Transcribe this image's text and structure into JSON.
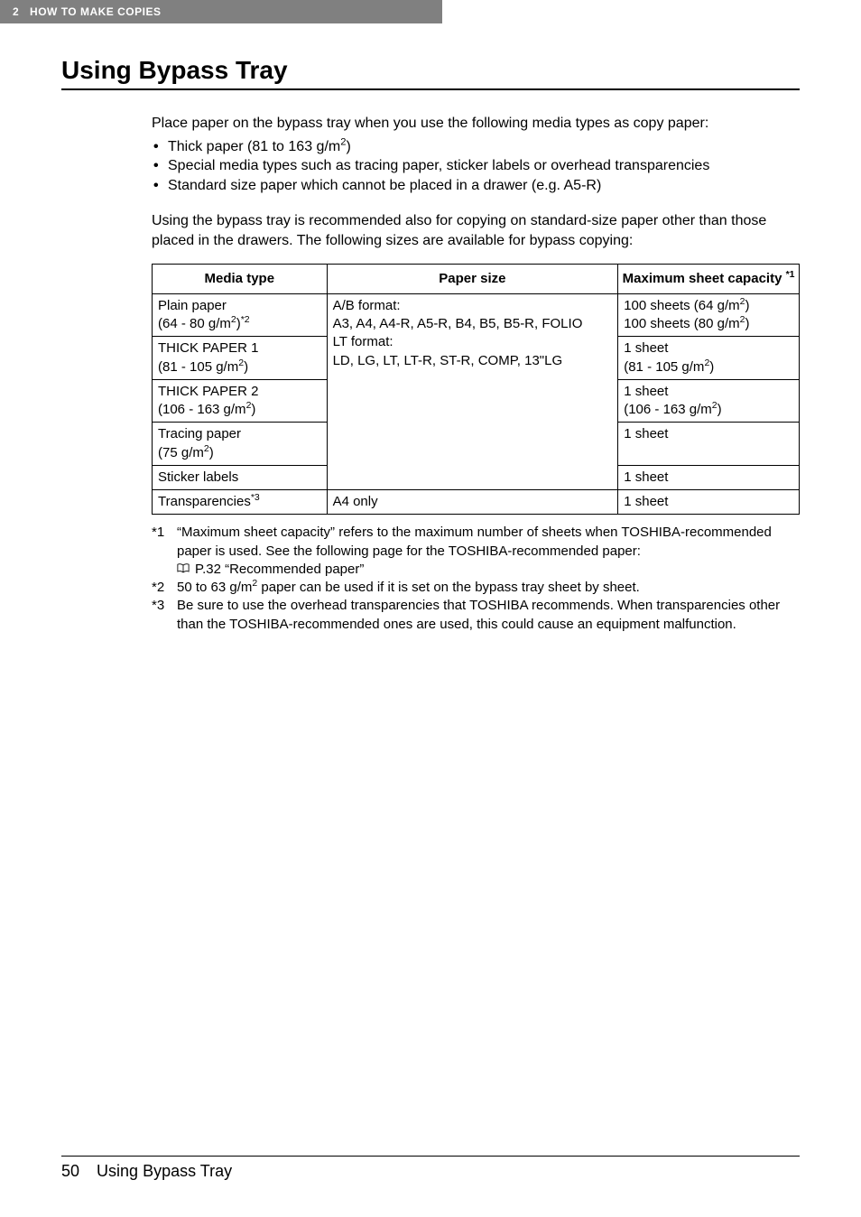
{
  "breadcrumb": {
    "num": "2",
    "label": "HOW TO MAKE COPIES"
  },
  "title": "Using Bypass Tray",
  "intro": "Place paper on the bypass tray when you use the following media types as copy paper:",
  "bullets": [
    {
      "pre": "Thick paper (81 to 163 g/m",
      "sup": "2",
      "post": ")"
    },
    {
      "text": "Special media types such as tracing paper, sticker labels or overhead transparencies"
    },
    {
      "text": "Standard size paper which cannot be placed in a drawer (e.g. A5-R)"
    }
  ],
  "para2": "Using the bypass tray is recommended also for copying on standard-size paper other than those placed in the drawers. The following sizes are available for bypass copying:",
  "table": {
    "headers": {
      "media": "Media type",
      "size": "Paper size",
      "capacity": "Maximum sheet capacity",
      "capacity_ref": "*1"
    },
    "sizeblock": {
      "l1": "A/B format:",
      "l2": "A3, A4, A4-R, A5-R, B4, B5, B5-R, FOLIO",
      "l3": "LT format:",
      "l4": "LD, LG, LT, LT-R, ST-R, COMP, 13\"LG"
    },
    "rows": {
      "r1": {
        "media_l1": "Plain paper",
        "media_l2_pre": "(64 - 80 g/m",
        "media_l2_sup": "2",
        "media_l2_post": ")",
        "media_l2_outersup": "*2",
        "cap_l1_pre": "100 sheets (64 g/m",
        "cap_l1_sup": "2",
        "cap_l1_post": ")",
        "cap_l2_pre": "100 sheets (80 g/m",
        "cap_l2_sup": "2",
        "cap_l2_post": ")"
      },
      "r2": {
        "media_l1": "THICK PAPER 1",
        "media_l2_pre": "(81 - 105 g/m",
        "media_l2_sup": "2",
        "media_l2_post": ")",
        "cap_l1": "1 sheet",
        "cap_l2_pre": "(81 - 105 g/m",
        "cap_l2_sup": "2",
        "cap_l2_post": ")"
      },
      "r3": {
        "media_l1": "THICK PAPER 2",
        "media_l2_pre": "(106 - 163 g/m",
        "media_l2_sup": "2",
        "media_l2_post": ")",
        "cap_l1": "1 sheet",
        "cap_l2_pre": "(106 - 163 g/m",
        "cap_l2_sup": "2",
        "cap_l2_post": ")"
      },
      "r4": {
        "media_l1": "Tracing paper",
        "media_l2_pre": "(75 g/m",
        "media_l2_sup": "2",
        "media_l2_post": ")",
        "cap_l1": "1 sheet"
      },
      "r5": {
        "media": "Sticker labels",
        "cap": "1 sheet"
      },
      "r6": {
        "media_pre": "Transparencies",
        "media_sup": "*3",
        "size": "A4 only",
        "cap": "1 sheet"
      }
    }
  },
  "footnotes": {
    "f1": {
      "marker": "*1",
      "line1": "“Maximum sheet capacity” refers to the maximum number of sheets when TOSHIBA-recommended paper is used. See the following page for the TOSHIBA-recommended paper:",
      "ref": " P.32 “Recommended paper”"
    },
    "f2": {
      "marker": "*2",
      "pre": "50 to 63 g/m",
      "sup": "2",
      "post": " paper can be used if it is set on the bypass tray sheet by sheet."
    },
    "f3": {
      "marker": "*3",
      "text": "Be sure to use the overhead transparencies that TOSHIBA recommends. When transparencies other than the TOSHIBA-recommended ones are used, this could cause an equipment malfunction."
    }
  },
  "footer": {
    "pagenum": "50",
    "label": "Using Bypass Tray"
  }
}
